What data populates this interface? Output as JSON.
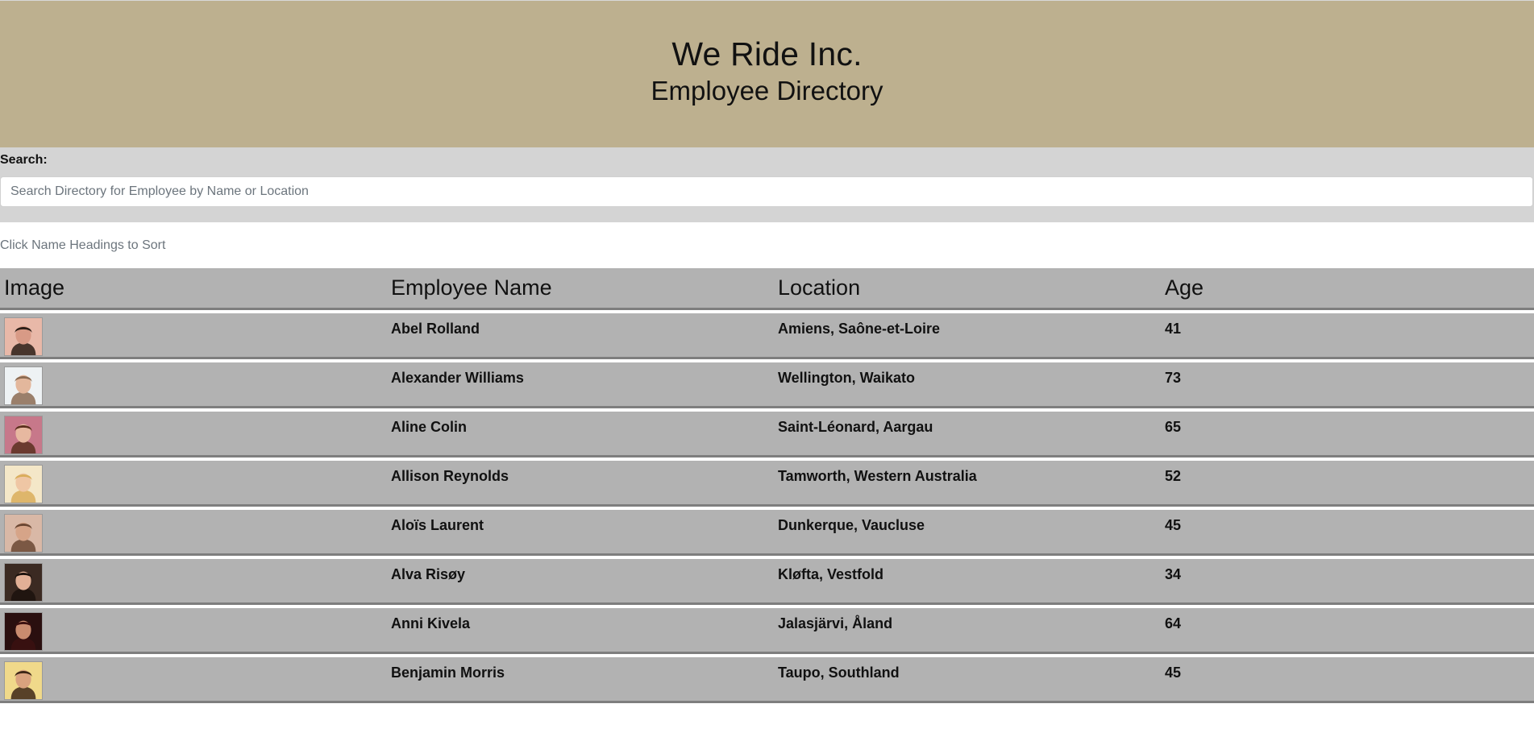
{
  "header": {
    "company": "We Ride Inc.",
    "subtitle": "Employee Directory"
  },
  "search": {
    "label": "Search:",
    "placeholder": "Search Directory for Employee by Name or Location",
    "value": ""
  },
  "sort_hint": "Click Name Headings to Sort",
  "table": {
    "columns": [
      "Image",
      "Employee Name",
      "Location",
      "Age"
    ],
    "rows": [
      {
        "name": "Abel Rolland",
        "location": "Amiens, Saône-et-Loire",
        "age": "41",
        "avatar": {
          "bg": "#e8b8a8",
          "face": "#d89a86",
          "hair": "#2b1d16"
        }
      },
      {
        "name": "Alexander Williams",
        "location": "Wellington, Waikato",
        "age": "73",
        "avatar": {
          "bg": "#eef2f4",
          "face": "#e3b79c",
          "hair": "#8b6b52"
        }
      },
      {
        "name": "Aline Colin",
        "location": "Saint-Léonard, Aargau",
        "age": "65",
        "avatar": {
          "bg": "#c7788a",
          "face": "#e7b8a0",
          "hair": "#5b2f1e"
        }
      },
      {
        "name": "Allison Reynolds",
        "location": "Tamworth, Western Australia",
        "age": "52",
        "avatar": {
          "bg": "#f4e7c8",
          "face": "#efc6a4",
          "hair": "#d9ad5a"
        }
      },
      {
        "name": "Aloïs Laurent",
        "location": "Dunkerque, Vaucluse",
        "age": "45",
        "avatar": {
          "bg": "#d9b8a6",
          "face": "#d6a488",
          "hair": "#6a4632"
        }
      },
      {
        "name": "Alva Risøy",
        "location": "Kløfta, Vestfold",
        "age": "34",
        "avatar": {
          "bg": "#3b2a22",
          "face": "#e2b096",
          "hair": "#1c120d"
        }
      },
      {
        "name": "Anni Kivela",
        "location": "Jalasjärvi, Åland",
        "age": "64",
        "avatar": {
          "bg": "#2a0f0f",
          "face": "#c98b6f",
          "hair": "#3b1010"
        }
      },
      {
        "name": "Benjamin Morris",
        "location": "Taupo, Southland",
        "age": "45",
        "avatar": {
          "bg": "#f0d98a",
          "face": "#d9a27e",
          "hair": "#3d2616"
        }
      }
    ]
  }
}
